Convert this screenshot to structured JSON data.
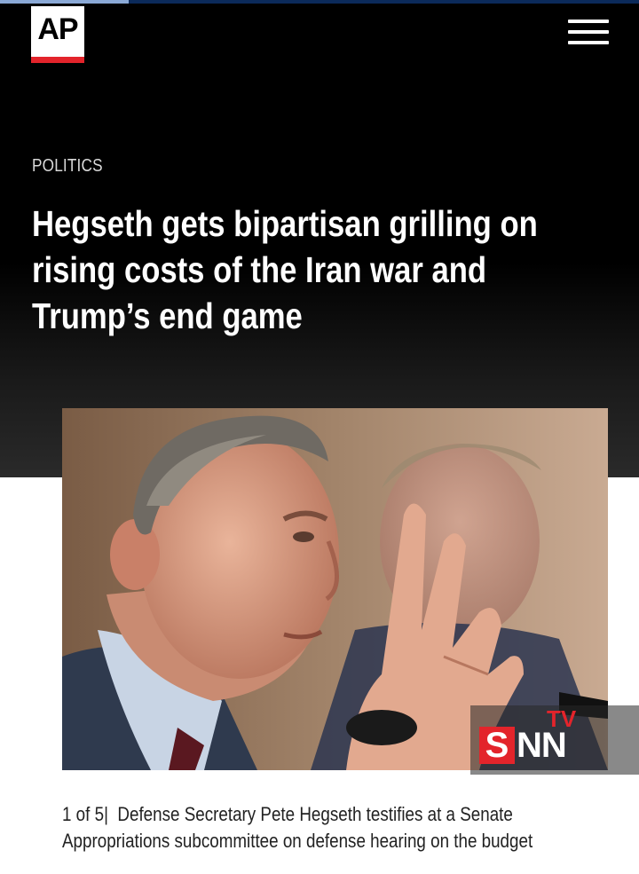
{
  "header": {
    "logo_text": "AP",
    "menu_icon": "hamburger-menu-icon"
  },
  "article": {
    "section": "POLITICS",
    "headline_lines": [
      "Hegseth gets bipartisan grilling on",
      "rising costs of the Iran war and",
      "Trump’s end game"
    ]
  },
  "media": {
    "counter": "1 of 5",
    "separator": "|",
    "caption_lines": [
      "Defense Secretary Pete Hegseth testifies at a Senate",
      "Appropriations subcommittee on defense hearing on the budget"
    ]
  },
  "watermark": {
    "s": "S",
    "nn": "NN",
    "tv": "TV"
  },
  "colors": {
    "ap_red": "#e3242b",
    "hero_bg": "#000000",
    "caption_text": "#222222"
  }
}
